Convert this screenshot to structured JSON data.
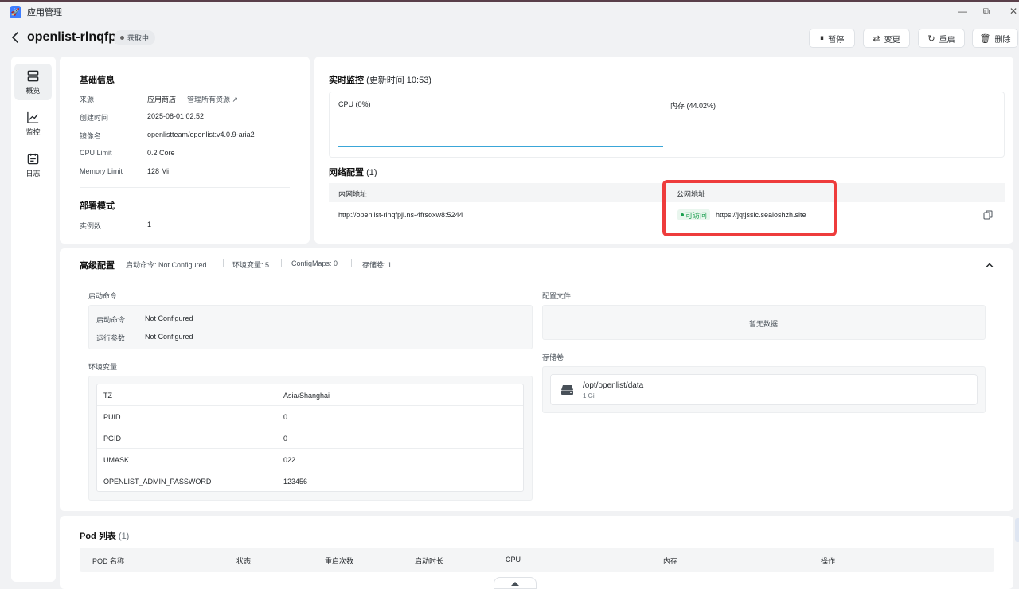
{
  "window": {
    "app_name": "应用管理",
    "controls": {
      "minimize": "—",
      "restore": "⧉",
      "close": "✕"
    }
  },
  "header": {
    "title": "openlist-rlnqfpji",
    "status": "获取中",
    "buttons": {
      "pause": "暂停",
      "change": "变更",
      "restart": "重启",
      "delete": "删除"
    }
  },
  "sidebar": {
    "items": [
      {
        "label": "概览",
        "icon": "overview-icon",
        "active": true
      },
      {
        "label": "监控",
        "icon": "chart-line-icon",
        "active": false
      },
      {
        "label": "日志",
        "icon": "calendar-log-icon",
        "active": false
      }
    ]
  },
  "basic_info": {
    "title": "基础信息",
    "source_label": "来源",
    "source_value": "应用商店",
    "manage_link": "管理所有资源",
    "created_label": "创建时间",
    "created_value": "2025-08-01 02:52",
    "image_label": "镜像名",
    "image_value": "openlistteam/openlist:v4.0.9-aria2",
    "cpu_label": "CPU Limit",
    "cpu_value": "0.2 Core",
    "mem_label": "Memory Limit",
    "mem_value": "128 Mi"
  },
  "deploy": {
    "title": "部署模式",
    "instances_label": "实例数",
    "instances_value": "1"
  },
  "monitor": {
    "title": "实时监控",
    "updated_label": "(更新时间 10:53)",
    "cpu_label": "CPU (0%)",
    "mem_label": "内存 (44.02%)"
  },
  "network": {
    "title": "网络配置",
    "count": "(1)",
    "col_private": "内网地址",
    "col_public": "公网地址",
    "private_addr": "http://openlist-rlnqfpji.ns-4frsoxw8:5244",
    "access_status": "可访问",
    "public_addr": "https://jqtjssic.sealoshzh.site"
  },
  "advanced": {
    "title": "高级配置",
    "meta": [
      "启动命令: Not Configured",
      "环境变量: 5",
      "ConfigMaps: 0",
      "存储卷: 1"
    ],
    "startup_title": "启动命令",
    "cmd_label": "启动命令",
    "cmd_value": "Not Configured",
    "args_label": "运行参数",
    "args_value": "Not Configured",
    "env_title": "环境变量",
    "env": [
      {
        "key": "TZ",
        "value": "Asia/Shanghai"
      },
      {
        "key": "PUID",
        "value": "0"
      },
      {
        "key": "PGID",
        "value": "0"
      },
      {
        "key": "UMASK",
        "value": "022"
      },
      {
        "key": "OPENLIST_ADMIN_PASSWORD",
        "value": "123456"
      }
    ],
    "config_title": "配置文件",
    "config_empty": "暂无数据",
    "storage_title": "存储卷",
    "volume_path": "/opt/openlist/data",
    "volume_size": "1 Gi"
  },
  "pods": {
    "title": "Pod 列表",
    "count": "(1)",
    "columns": [
      "POD 名称",
      "状态",
      "重启次数",
      "启动时长",
      "CPU",
      "内存",
      "操作"
    ]
  },
  "colors": {
    "accent": "#3e7dff",
    "success": "#1a9f4f",
    "highlight": "#ee3c3c",
    "cpu_line": "#3aa6d8"
  }
}
